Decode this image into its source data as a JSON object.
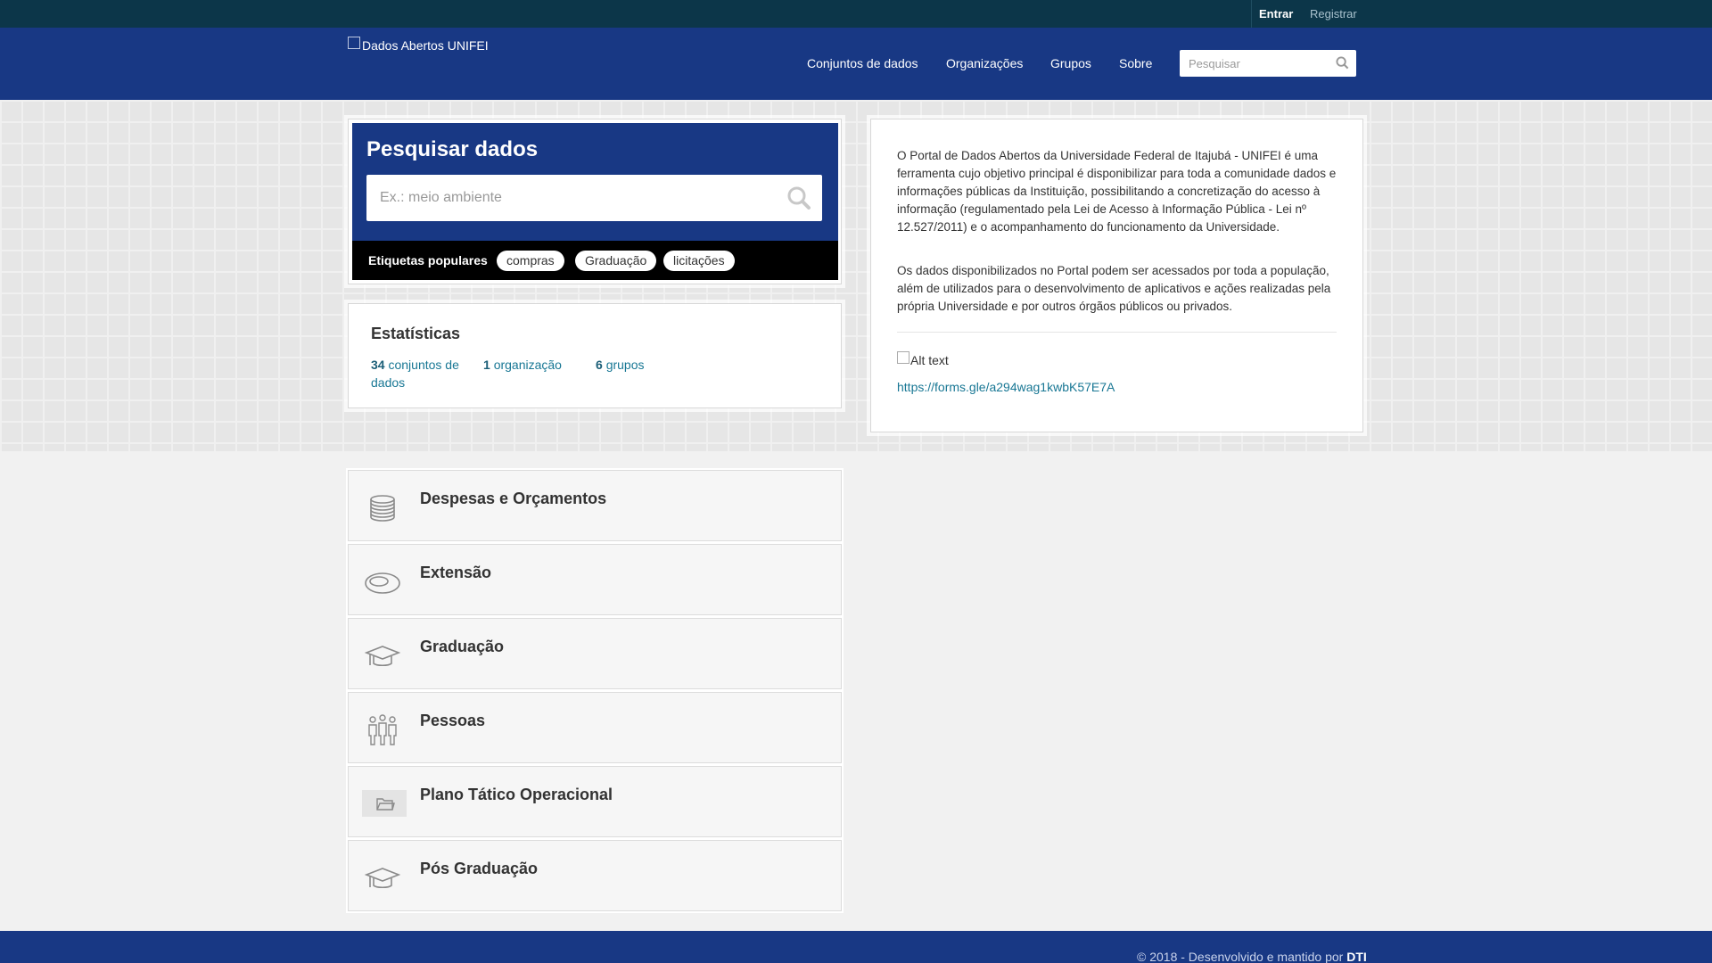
{
  "topbar": {
    "login": "Entrar",
    "register": "Registrar"
  },
  "header": {
    "logo_alt": "Dados Abertos UNIFEI",
    "nav": [
      "Conjuntos de dados",
      "Organizações",
      "Grupos",
      "Sobre"
    ],
    "search_placeholder": "Pesquisar"
  },
  "search": {
    "title": "Pesquisar dados",
    "placeholder": "Ex.: meio ambiente",
    "tags_label": "Etiquetas populares",
    "tags": [
      "compras",
      "Graduação",
      "licitações"
    ]
  },
  "stats": {
    "title": "Estatísticas",
    "items": [
      {
        "count": "34",
        "label": "conjuntos de dados"
      },
      {
        "count": "1",
        "label": "organização"
      },
      {
        "count": "6",
        "label": "grupos"
      }
    ]
  },
  "info": {
    "p1": "O Portal de Dados Abertos da Universidade Federal de Itajubá - UNIFEI é uma ferramenta cujo objetivo principal é disponibilizar para toda a comunidade dados e informações públicas da Instituição, possibilitando a concretização do acesso à informação (regulamentado pela Lei de Acesso à Informação Pública - Lei nº 12.527/2011) e o acompanhamento do funcionamento da Universidade.",
    "p2": "Os dados disponibilizados no Portal podem ser acessados por toda a população, além de utilizados para o desenvolvimento de aplicativos e ações realizadas pela própria Universidade e por outros órgãos públicos ou privados.",
    "img_alt": "Alt text",
    "link": "https://forms.gle/a294wag1kwbK57E7A"
  },
  "groups": [
    {
      "name": "Despesas e Orçamentos",
      "icon": "coins-icon"
    },
    {
      "name": "Extensão",
      "icon": "oval-icon"
    },
    {
      "name": "Graduação",
      "icon": "graduation-cap-icon"
    },
    {
      "name": "Pessoas",
      "icon": "people-icon"
    },
    {
      "name": "Plano Tático Operacional",
      "icon": "folder-icon"
    },
    {
      "name": "Pós Graduação",
      "icon": "graduation-cap-icon"
    }
  ],
  "footer": {
    "credit_prefix": "© 2018 - Desenvolvido e mantido por",
    "credit_org": "DTI"
  }
}
